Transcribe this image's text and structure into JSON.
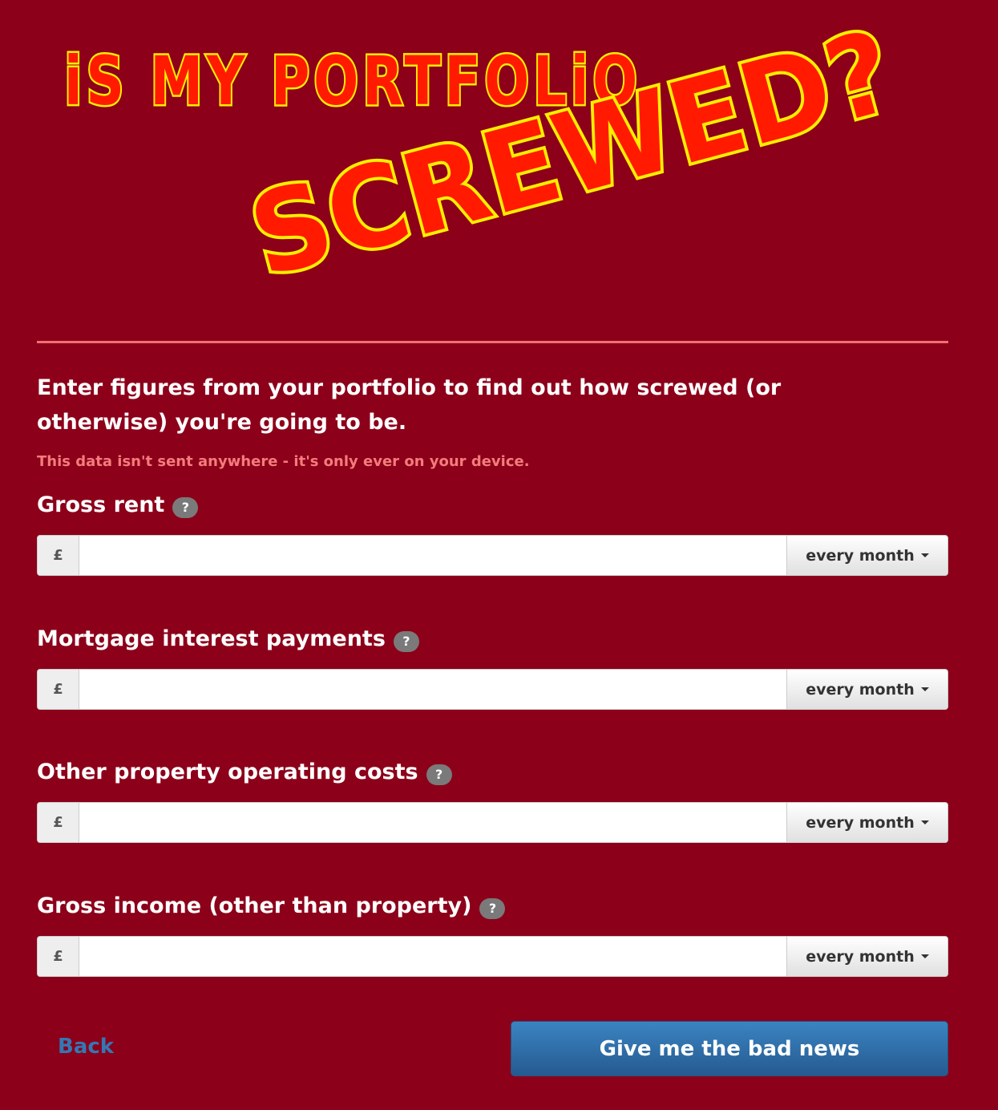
{
  "logo": {
    "line1": "iS MY PORTFOLiO",
    "line2": "SCREWED?"
  },
  "intro": "Enter figures from your portfolio to find out how screwed (or otherwise) you're going to be.",
  "privacy_note": "This data isn't sent anywhere - it's only ever on your device.",
  "fields": [
    {
      "label": "Gross rent",
      "help": "?",
      "currency": "£",
      "value": "",
      "period": "every month"
    },
    {
      "label": "Mortgage interest payments",
      "help": "?",
      "currency": "£",
      "value": "",
      "period": "every month"
    },
    {
      "label": "Other property operating costs",
      "help": "?",
      "currency": "£",
      "value": "",
      "period": "every month"
    },
    {
      "label": "Gross income (other than property)",
      "help": "?",
      "currency": "£",
      "value": "",
      "period": "every month"
    }
  ],
  "back_label": "Back",
  "submit_label": "Give me the bad news",
  "colors": {
    "background": "#8c001a",
    "logo_fill": "#ff1a00",
    "logo_outline": "#ffee00",
    "divider": "#f07070",
    "privacy": "#f47c7c",
    "link": "#3378b5",
    "button": "#2f6ea8"
  }
}
